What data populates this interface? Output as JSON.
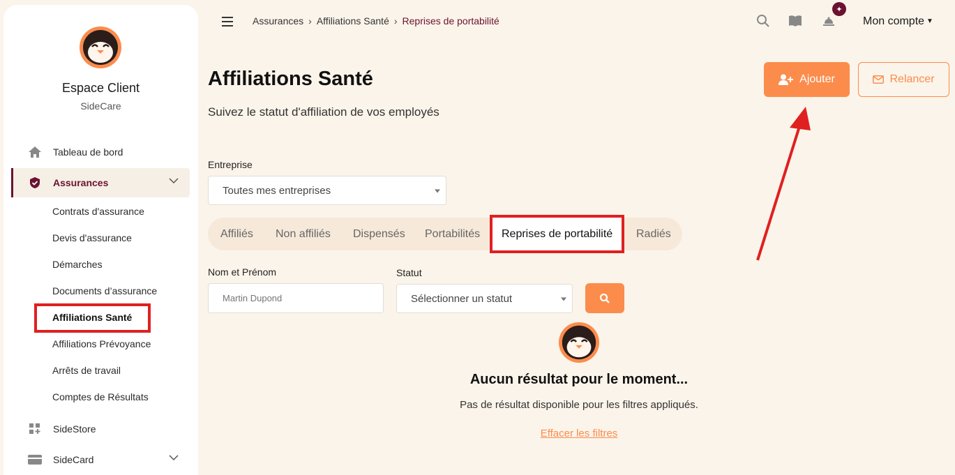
{
  "sidebar": {
    "brand_title": "Espace Client",
    "brand_sub": "SideCare",
    "nav": {
      "dashboard": "Tableau de bord",
      "assurances": "Assurances",
      "sidestore": "SideStore",
      "sidecard": "SideCard"
    },
    "sub_items": [
      "Contrats d'assurance",
      "Devis d'assurance",
      "Démarches",
      "Documents d’assurance",
      "Affiliations Santé",
      "Affiliations Prévoyance",
      "Arrêts de travail",
      "Comptes de Résultats"
    ]
  },
  "topbar": {
    "breadcrumb": [
      "Assurances",
      "Affiliations Santé",
      "Reprises de portabilité"
    ],
    "account": "Mon compte",
    "icons": [
      "search-icon",
      "book-icon",
      "bell-icon",
      "sparkle-badge-icon"
    ]
  },
  "header": {
    "title": "Affiliations Santé",
    "subtitle": "Suivez le statut d'affiliation de vos employés",
    "add_button": "Ajouter",
    "remind_button": "Relancer"
  },
  "filters": {
    "company_label": "Entreprise",
    "company_value": "Toutes mes entreprises",
    "name_label": "Nom et Prénom",
    "name_placeholder": "Martin Dupond",
    "status_label": "Statut",
    "status_value": "Sélectionner un statut"
  },
  "tabs": [
    "Affiliés",
    "Non affiliés",
    "Dispensés",
    "Portabilités",
    "Reprises de portabilité",
    "Radiés"
  ],
  "active_tab": "Reprises de portabilité",
  "empty_state": {
    "title": "Aucun résultat pour le moment...",
    "subtitle": "Pas de résultat disponible pour les filtres appliqués.",
    "clear_link": "Effacer les filtres"
  },
  "colors": {
    "accent": "#fb8c4c",
    "brand": "#6b1230",
    "highlight": "#e02020",
    "background": "#fbf4ea"
  }
}
